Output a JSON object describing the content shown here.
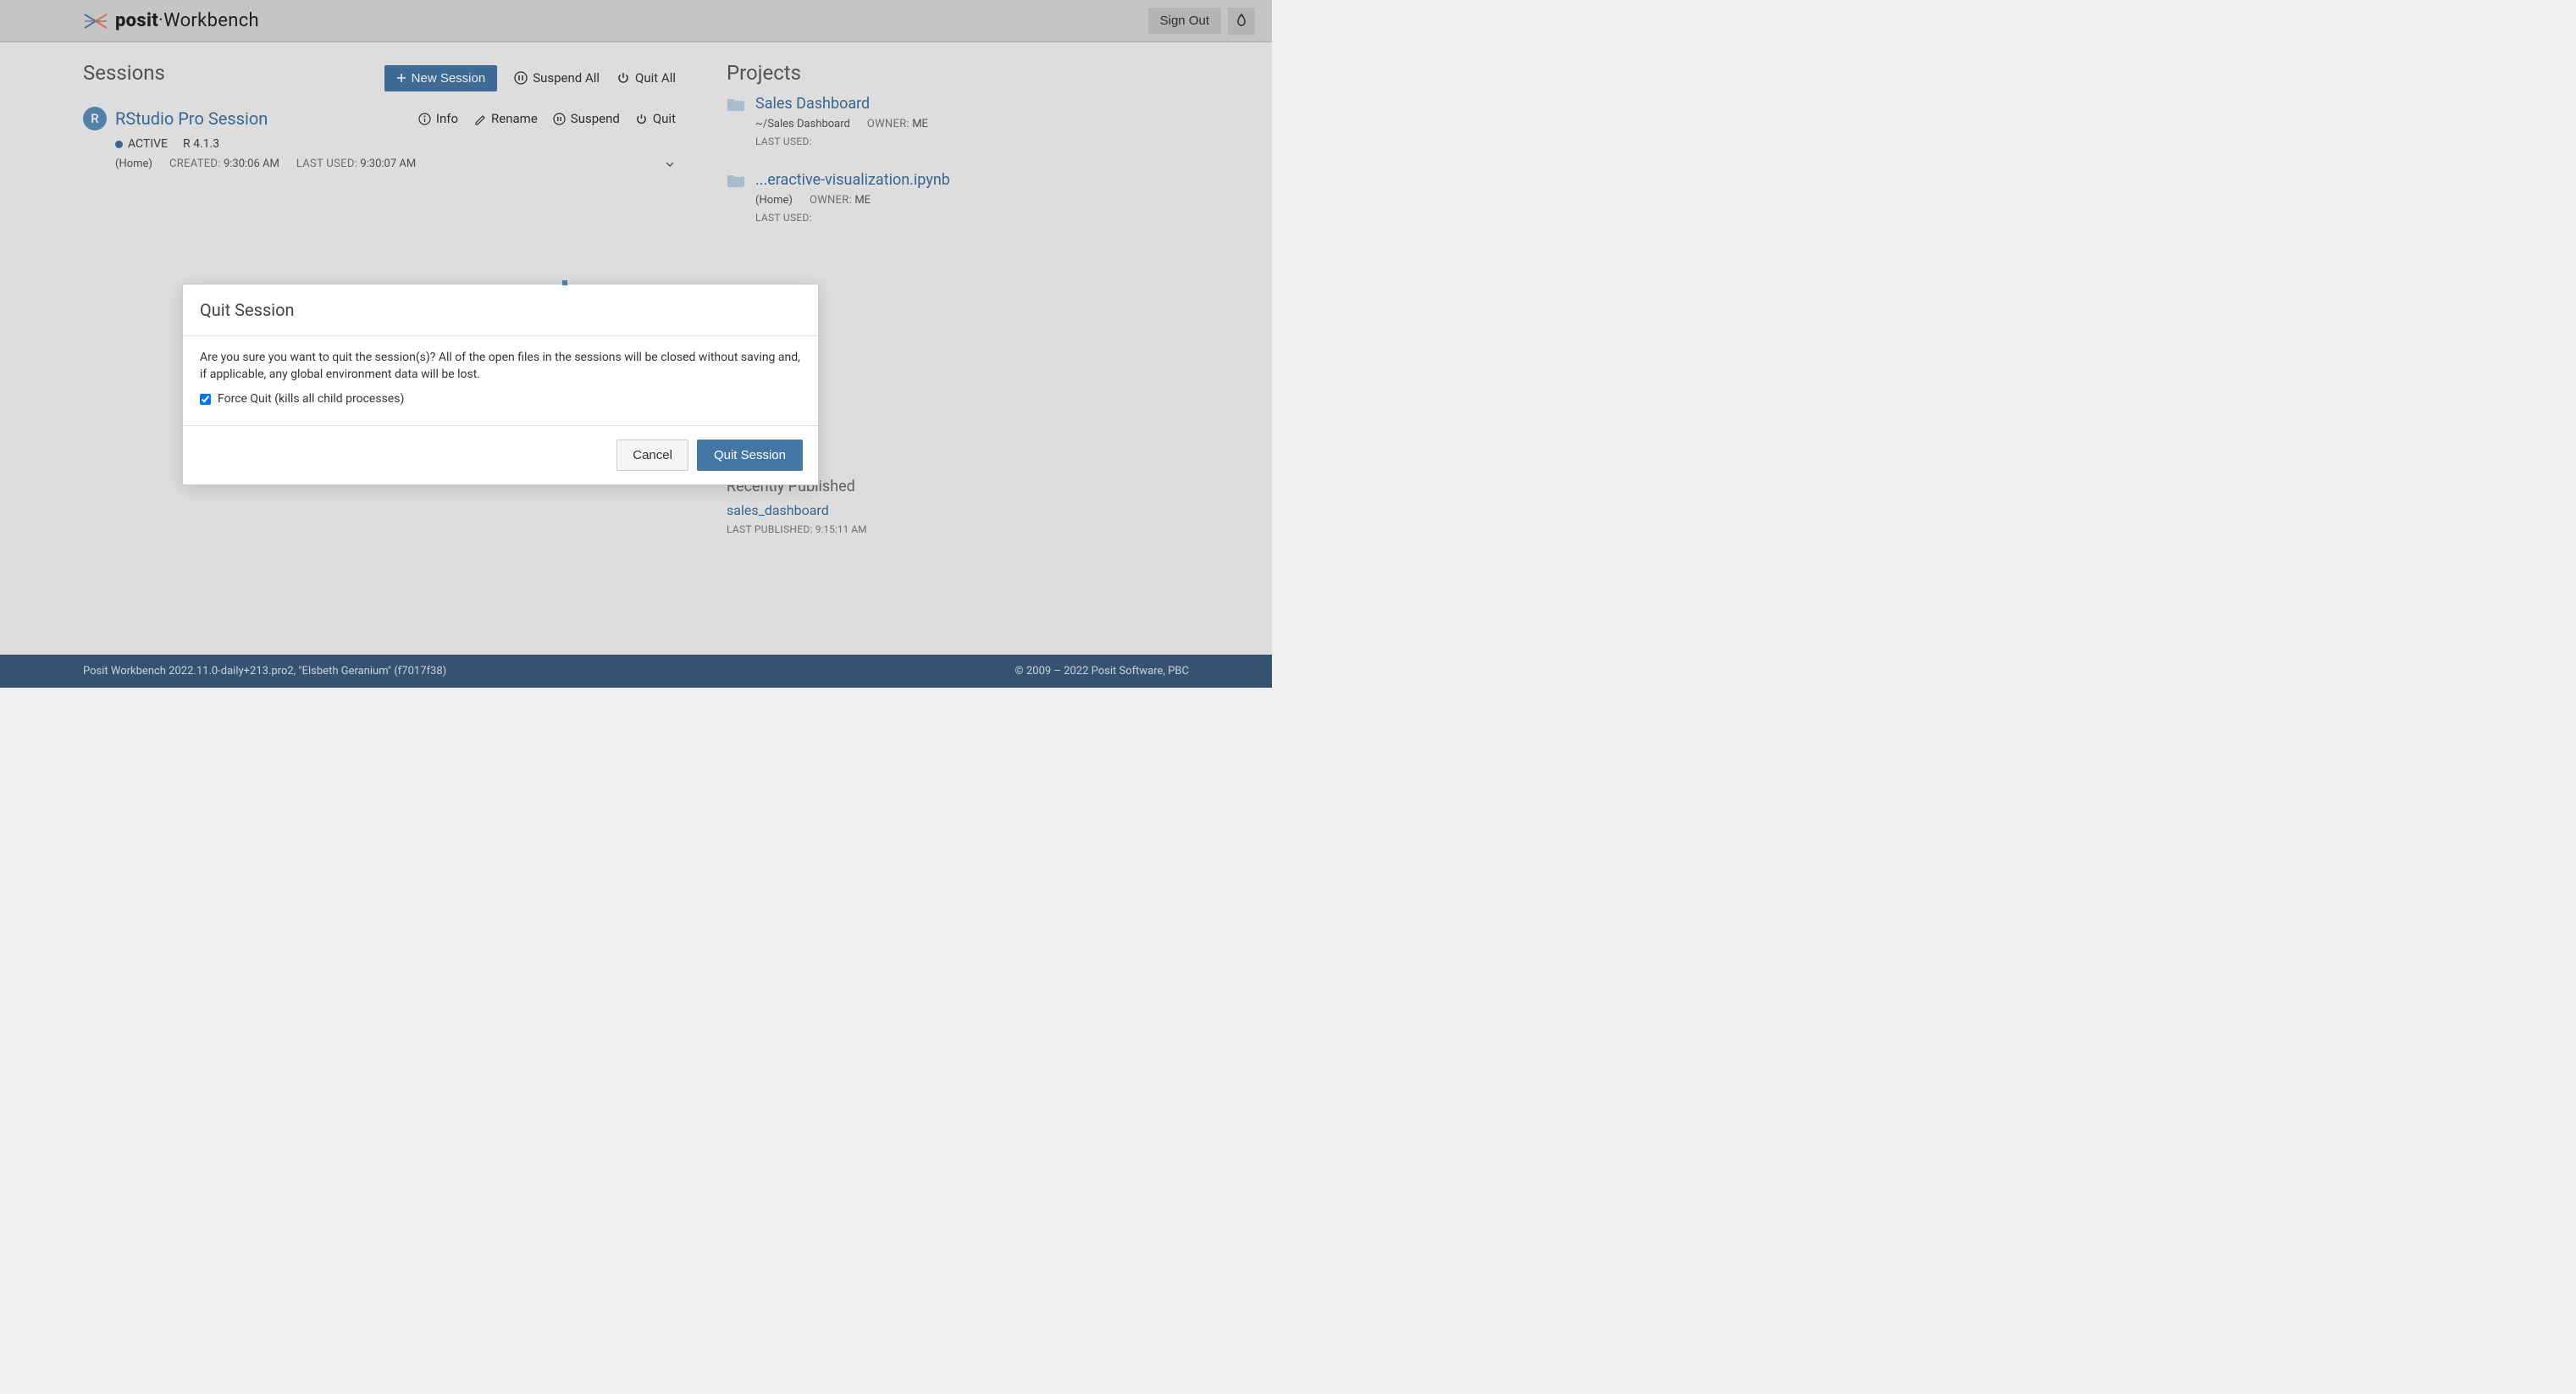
{
  "header": {
    "brand_posit": "posit",
    "brand_workbench": "Workbench",
    "sign_out": "Sign Out"
  },
  "sessions": {
    "title": "Sessions",
    "new_session": "New Session",
    "suspend_all": "Suspend All",
    "quit_all": "Quit All",
    "items": [
      {
        "badge": "R",
        "name": "RStudio Pro Session",
        "actions": {
          "info": "Info",
          "rename": "Rename",
          "suspend": "Suspend",
          "quit": "Quit"
        },
        "status": "ACTIVE",
        "runtime": "R 4.1.3",
        "home": "(Home)",
        "created_label": "CREATED:",
        "created_value": "9:30:06 AM",
        "last_used_label": "LAST USED:",
        "last_used_value": "9:30:07 AM"
      }
    ]
  },
  "projects": {
    "title": "Projects",
    "items": [
      {
        "name": "Sales Dashboard",
        "path": "~/Sales Dashboard",
        "owner_label": "OWNER:",
        "owner_value": "ME",
        "last_used_label": "LAST USED:"
      },
      {
        "name": "...eractive-visualization.ipynb",
        "path": "(Home)",
        "owner_label": "OWNER:",
        "owner_value": "ME",
        "last_used_label": "LAST USED:"
      }
    ]
  },
  "recent": {
    "title": "Recently Published",
    "item_name": "sales_dashboard",
    "last_published_label": "LAST PUBLISHED:",
    "last_published_value": "9:15:11 AM"
  },
  "footer": {
    "left": "Posit Workbench 2022.11.0-daily+213.pro2, \"Elsbeth Geranium\" (f7017f38)",
    "right": "© 2009 – 2022  Posit Software, PBC"
  },
  "modal": {
    "title": "Quit Session",
    "body": "Are you sure you want to quit the session(s)? All of the open files in the sessions will be closed without saving and, if applicable, any global environment data will be lost.",
    "force_quit_label": "Force Quit (kills all child processes)",
    "cancel": "Cancel",
    "confirm": "Quit Session"
  }
}
